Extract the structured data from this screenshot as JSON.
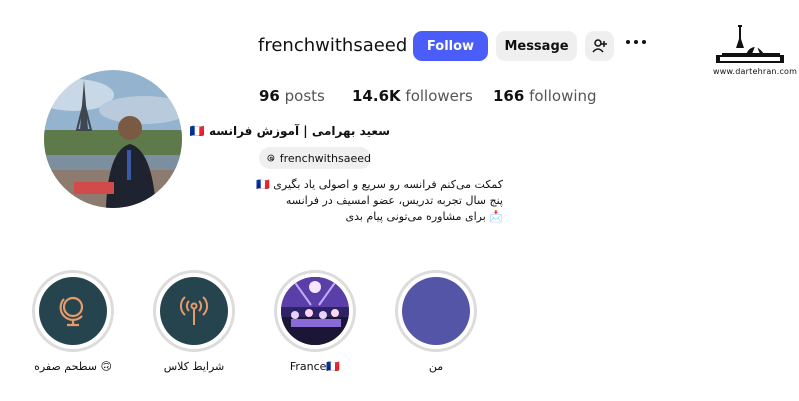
{
  "profile": {
    "username": "frenchwithsaeed",
    "follow_label": "Follow",
    "message_label": "Message",
    "stats": {
      "posts_count": "96",
      "posts_label": "posts",
      "followers_count": "14.6K",
      "followers_label": "followers",
      "following_count": "166",
      "following_label": "following"
    },
    "full_name": "سعید بهرامی | آموزش فرانسه 🇫🇷",
    "threads_handle": "frenchwithsaeed",
    "bio_lines": [
      "کمکت می‌کنم فرانسه رو سریع و اصولی یاد بگیری 🇫🇷",
      "پنج سال تجربه تدریس، عضو امسیف در فرانسه",
      "📩 برای مشاوره می‌تونی پیام بدی"
    ]
  },
  "highlights": [
    {
      "label": "سطحم صفره 🙃",
      "icon": "globe-icon",
      "bg": "#25444d",
      "icon_color": "#e79a6a"
    },
    {
      "label": "شرایط کلاس",
      "icon": "broadcast-icon",
      "bg": "#25444d",
      "icon_color": "#e79a6a"
    },
    {
      "label": "France🇫🇷",
      "icon": "concert-photo",
      "bg": "#3b2a6e"
    },
    {
      "label": "من",
      "icon": "",
      "bg": "#5455a6"
    }
  ],
  "watermark": {
    "url": "www.dartehran.com"
  },
  "colors": {
    "accent": "#4a5df9",
    "button_gray": "#efefef",
    "highlight_ring": "#dcdcdc"
  }
}
